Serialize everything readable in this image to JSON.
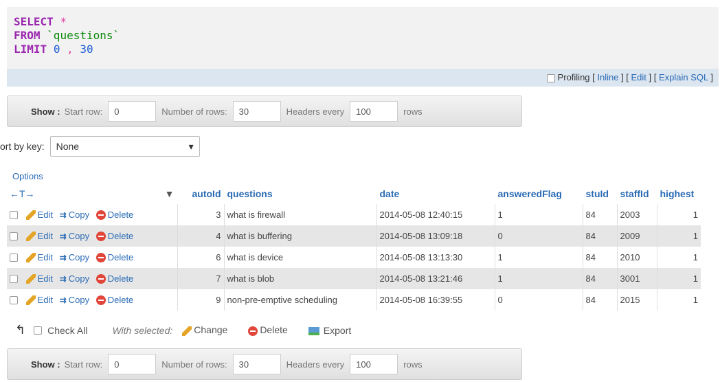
{
  "sql": {
    "select": "SELECT",
    "star": "*",
    "from": "FROM",
    "table": "`questions`",
    "limit": "LIMIT",
    "zero": "0",
    "comma": ",",
    "thirty": "30"
  },
  "profiling": {
    "label": "Profiling",
    "inline": "Inline",
    "edit": "Edit",
    "explain": "Explain SQL"
  },
  "nav": {
    "show": "Show :",
    "start_label": "Start row:",
    "start_value": "0",
    "rows_label": "Number of rows:",
    "rows_value": "30",
    "headers_label": "Headers every",
    "headers_value": "100",
    "rows_suffix": "rows"
  },
  "sort": {
    "label": "ort by key:",
    "value": "None"
  },
  "options_label": "Options",
  "columns": [
    "autoId",
    "questions",
    "date",
    "answeredFlag",
    "stuId",
    "staffId",
    "highest"
  ],
  "actions": {
    "edit": "Edit",
    "copy": "Copy",
    "delete": "Delete"
  },
  "rows": [
    {
      "autoId": "3",
      "question": "what is firewall",
      "date": "2014-05-08 12:40:15",
      "flag": "1",
      "stuId": "84",
      "staffId": "2003",
      "highest": "1"
    },
    {
      "autoId": "4",
      "question": "what is buffering",
      "date": "2014-05-08 13:09:18",
      "flag": "0",
      "stuId": "84",
      "staffId": "2009",
      "highest": "1"
    },
    {
      "autoId": "6",
      "question": "what is device",
      "date": "2014-05-08 13:13:30",
      "flag": "1",
      "stuId": "84",
      "staffId": "2010",
      "highest": "1"
    },
    {
      "autoId": "7",
      "question": "what is blob",
      "date": "2014-05-08 13:21:46",
      "flag": "1",
      "stuId": "84",
      "staffId": "3001",
      "highest": "1"
    },
    {
      "autoId": "9",
      "question": "non-pre-emptive scheduling",
      "date": "2014-05-08 16:39:55",
      "flag": "0",
      "stuId": "84",
      "staffId": "2015",
      "highest": "1"
    }
  ],
  "footer": {
    "check_all": "Check All",
    "with_selected": "With selected:",
    "change": "Change",
    "delete": "Delete",
    "export": "Export"
  }
}
